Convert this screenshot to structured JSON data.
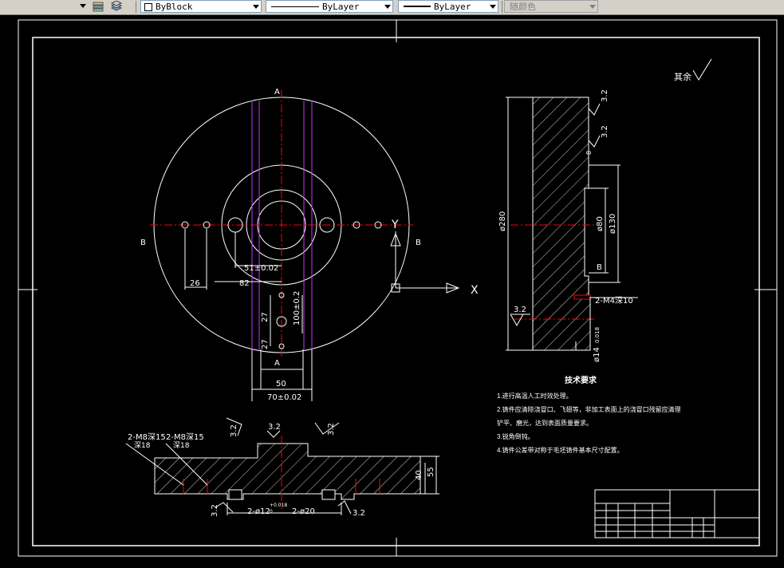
{
  "toolbar": {
    "color_value": "ByBlock",
    "linetype_value": "ByLayer",
    "lineweight_value": "ByLayer",
    "plotstyle_value": "随颜色",
    "layer_icon": "layers-icon",
    "layer_state_icon": "layer-stack-icon"
  },
  "drawing": {
    "roughness_label": "其余",
    "section_a_top": "A",
    "section_a_bottom": "A",
    "section_b_left": "B",
    "section_b_right": "B",
    "axis_y": "Y",
    "axis_x": "X",
    "dims_plan": [
      "51±0.02",
      "82",
      "26",
      "27",
      "27",
      "100±0.2",
      "50",
      "70±0.02"
    ],
    "dims_side": [
      "3.2",
      "3.2",
      "ø280",
      "ø80",
      "ø130",
      "B",
      "2-M4深10",
      "3.2",
      "ø14",
      "0.018",
      "8"
    ],
    "dims_front": [
      "2-M8深15",
      "深18",
      "2-M8深15",
      "深18",
      "3.2",
      "3.2",
      "3.2",
      "40",
      "55",
      "3.2",
      "2-ø12",
      "+0.018",
      "0",
      "2-ø20",
      "3.2"
    ],
    "notes_title": "技术要求",
    "notes": [
      "1.进行高温人工时效处理。",
      "2.铸件应清除浇冒口、飞翅等，非加工表面上的浇冒口残留应清理",
      "铲平、磨光，达到表面质量要求。",
      "3.锐角倒钝。",
      "4.铸件公差带对称于毛坯铸件基本尺寸配置。"
    ]
  },
  "colors": {
    "background": "#000000",
    "line": "#ffffff",
    "centerline": "#ff0000",
    "magenta": "#cc33ff"
  }
}
